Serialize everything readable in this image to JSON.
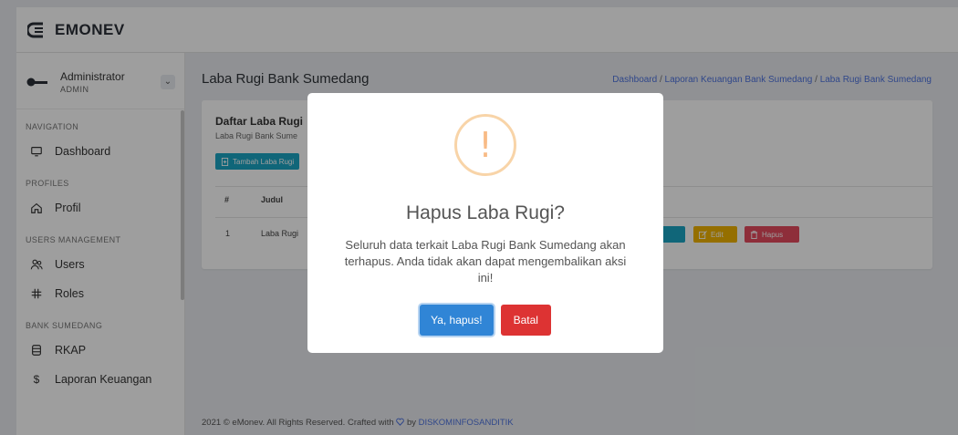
{
  "brand": {
    "name": "EMONEV"
  },
  "user": {
    "name": "Administrator",
    "role": "ADMIN",
    "toggle_icon": "chevron-down-icon"
  },
  "sidebar": {
    "sections": [
      {
        "label": "NAVIGATION",
        "items": [
          {
            "label": "Dashboard",
            "icon": "monitor-icon"
          }
        ]
      },
      {
        "label": "PROFILES",
        "items": [
          {
            "label": "Profil",
            "icon": "home-icon"
          }
        ]
      },
      {
        "label": "USERS MANAGEMENT",
        "items": [
          {
            "label": "Users",
            "icon": "users-icon"
          },
          {
            "label": "Roles",
            "icon": "grid-icon"
          }
        ]
      },
      {
        "label": "BANK SUMEDANG",
        "items": [
          {
            "label": "RKAP",
            "icon": "database-icon"
          },
          {
            "label": "Laporan Keuangan",
            "icon": "dollar-icon"
          }
        ]
      }
    ]
  },
  "page": {
    "title": "Laba Rugi Bank Sumedang",
    "breadcrumb": [
      "Dashboard",
      "/",
      "Laporan Keuangan Bank Sumedang",
      "/",
      "Laba Rugi Bank Sumedang"
    ]
  },
  "card": {
    "title": "Daftar Laba Rugi",
    "subtitle": "Laba Rugi Bank Sume",
    "add_button": "Tambah Laba Rugi",
    "table": {
      "headers": [
        "#",
        "Judul"
      ],
      "rows": [
        {
          "num": "1",
          "judul": "Laba Rugi"
        }
      ],
      "actions": {
        "detail": "tail",
        "edit": "Edit",
        "hapus": "Hapus"
      }
    }
  },
  "footer": {
    "text": "2021 © eMonev. All Rights Reserved. Crafted with",
    "by": "by",
    "link": "DISKOMINFOSANDITIK"
  },
  "modal": {
    "icon": "warning-icon",
    "title": "Hapus Laba Rugi?",
    "text": "Seluruh data terkait Laba Rugi Bank Sumedang akan terhapus. Anda tidak akan dapat mengembalikan aksi ini!",
    "confirm_label": "Ya, hapus!",
    "cancel_label": "Batal"
  },
  "colors": {
    "accent": "#3085d6",
    "danger": "#dd3333",
    "info": "#1aa5c4",
    "warning": "#f0b400",
    "link": "#4e73df"
  }
}
